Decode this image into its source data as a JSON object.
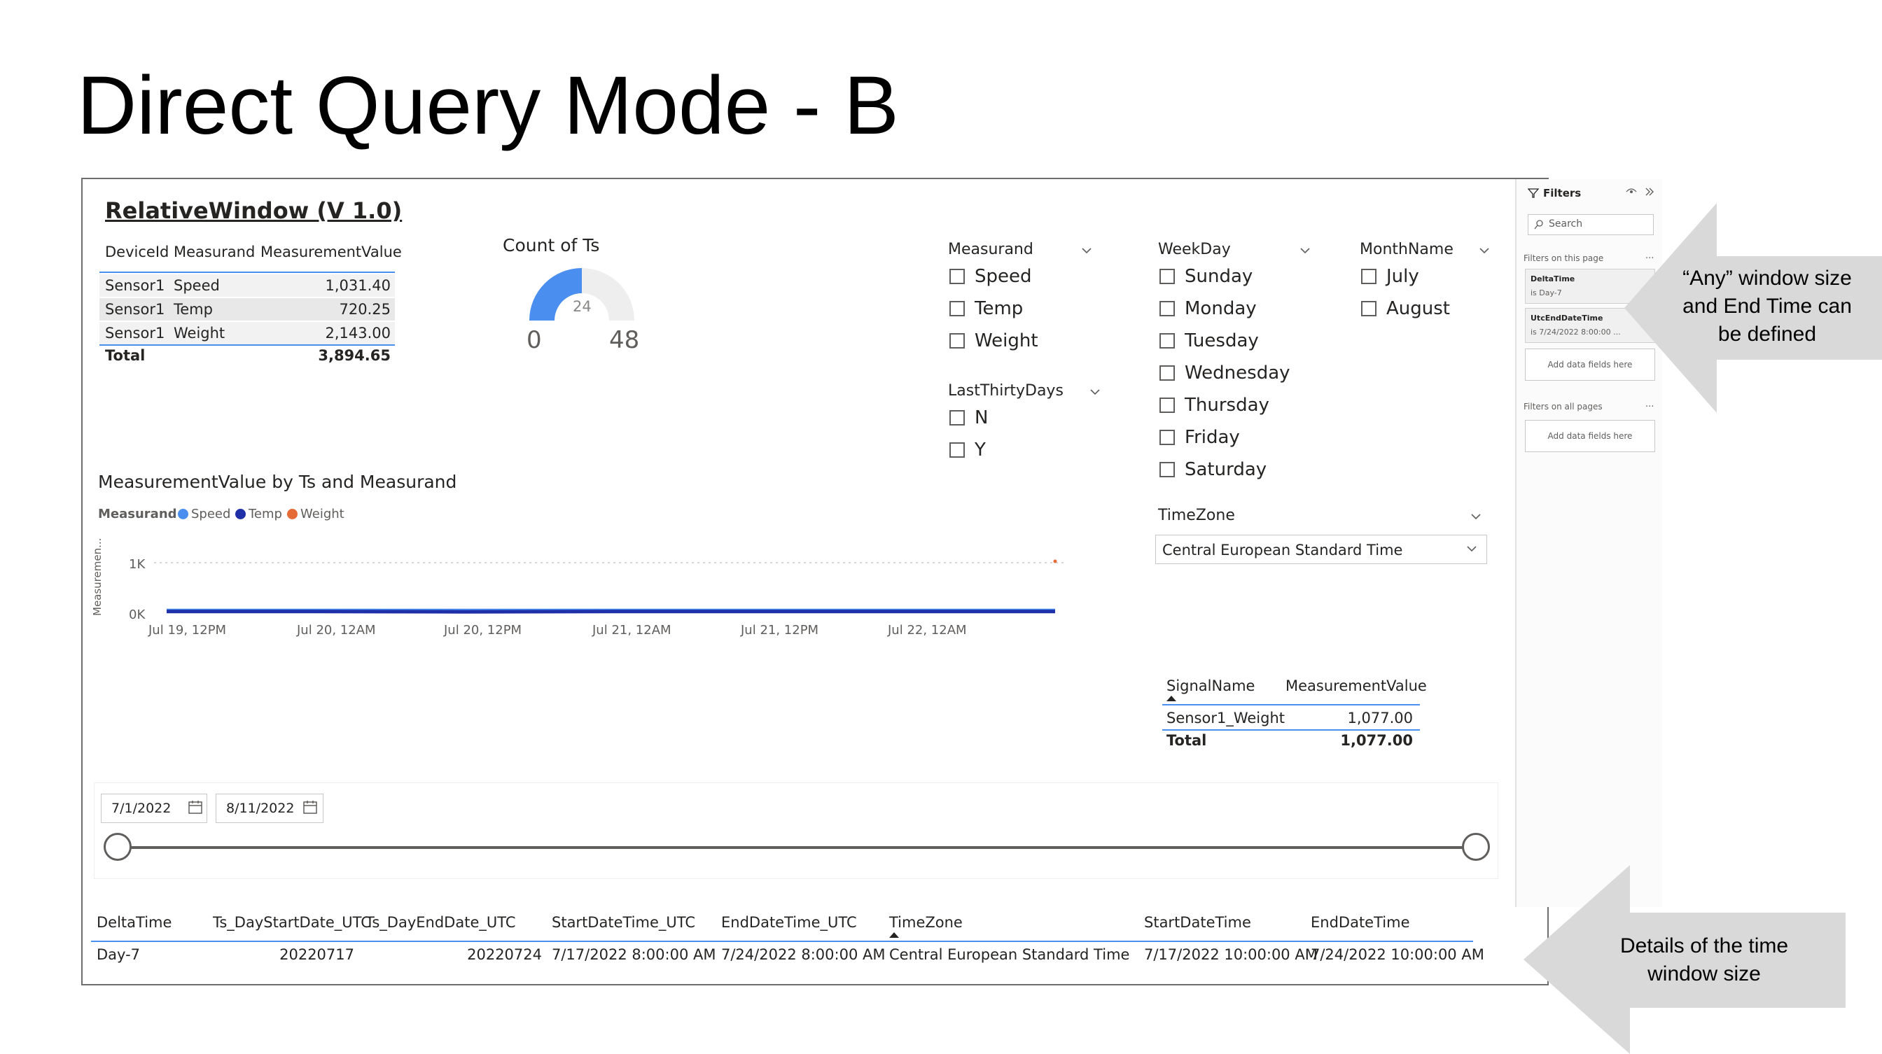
{
  "slide": {
    "title": "Direct Query Mode - B"
  },
  "summary_table": {
    "title": "RelativeWindow (V 1.0)",
    "headers": [
      "DeviceId",
      "Measurand",
      "MeasurementValue"
    ],
    "rows": [
      [
        "Sensor1",
        "Speed",
        "1,031.40"
      ],
      [
        "Sensor1",
        "Temp",
        "720.25"
      ],
      [
        "Sensor1",
        "Weight",
        "2,143.00"
      ]
    ],
    "total_label": "Total",
    "total_value": "3,894.65"
  },
  "gauge": {
    "title": "Count of Ts",
    "value": 24,
    "min": 0,
    "max": 48,
    "value_label": "24",
    "min_label": "0",
    "max_label": "48",
    "color": "#4a8ef0"
  },
  "slicers": {
    "measurand": {
      "title": "Measurand",
      "options": [
        "Speed",
        "Temp",
        "Weight"
      ]
    },
    "last_thirty_days": {
      "title": "LastThirtyDays",
      "options": [
        "N",
        "Y"
      ]
    },
    "weekday": {
      "title": "WeekDay",
      "options": [
        "Sunday",
        "Monday",
        "Tuesday",
        "Wednesday",
        "Thursday",
        "Friday",
        "Saturday"
      ]
    },
    "month_name": {
      "title": "MonthName",
      "options": [
        "July",
        "August"
      ]
    },
    "timezone": {
      "title": "TimeZone",
      "selected": "Central European Standard Time"
    }
  },
  "chart_data": {
    "type": "line",
    "title": "MeasurementValue by Ts and Measurand",
    "legend_title": "Measurand",
    "legend_position": "top-left",
    "ylabel": "Measuremen...",
    "xlabel": "",
    "y_ticks": [
      "1K",
      "0K"
    ],
    "ylim": [
      0,
      1000
    ],
    "x_ticks": [
      "Jul 19, 12PM",
      "Jul 20, 12AM",
      "Jul 20, 12PM",
      "Jul 21, 12AM",
      "Jul 21, 12PM",
      "Jul 22, 12AM"
    ],
    "x": [
      "Jul 19, 12PM",
      "Jul 20, 12AM",
      "Jul 20, 12PM",
      "Jul 21, 12AM",
      "Jul 21, 12PM",
      "Jul 22, 12AM",
      "Jul 22, 12PM"
    ],
    "grid": true,
    "series": [
      {
        "name": "Speed",
        "color": "#4a8ef0",
        "values": [
          60,
          60,
          60,
          60,
          60,
          60,
          60
        ]
      },
      {
        "name": "Temp",
        "color": "#1f2fa8",
        "values": [
          30,
          30,
          25,
          30,
          30,
          30,
          30
        ]
      },
      {
        "name": "Weight",
        "color": "#e66c37",
        "values": [
          null,
          null,
          null,
          null,
          null,
          null,
          1077
        ]
      }
    ]
  },
  "signal_table": {
    "headers": [
      "SignalName",
      "MeasurementValue"
    ],
    "rows": [
      [
        "Sensor1_Weight",
        "1,077.00"
      ]
    ],
    "total_label": "Total",
    "total_value": "1,077.00"
  },
  "date_range": {
    "start": "7/1/2022",
    "end": "8/11/2022",
    "slider_start": 0,
    "slider_end": 1
  },
  "details_table": {
    "headers": [
      "DeltaTime",
      "Ts_DayStartDate_UTC",
      "Ts_DayEndDate_UTC",
      "StartDateTime_UTC",
      "EndDateTime_UTC",
      "TimeZone",
      "StartDateTime",
      "EndDateTime"
    ],
    "row": [
      "Day-7",
      "20220717",
      "20220724",
      "7/17/2022 8:00:00 AM",
      "7/24/2022 8:00:00 AM",
      "Central European Standard Time",
      "7/17/2022 10:00:00 AM",
      "7/24/2022 10:00:00 AM"
    ]
  },
  "filters_pane": {
    "title": "Filters",
    "search_placeholder": "Search",
    "on_this_page": "Filters on this page",
    "cards": [
      {
        "name": "DeltaTime",
        "value": "is Day-7"
      },
      {
        "name": "UtcEndDateTime",
        "value": "is 7/24/2022 8:00:00 ..."
      }
    ],
    "add_fields": "Add data fields here",
    "on_all_pages": "Filters on all pages",
    "more": "..."
  },
  "callouts": {
    "top_right": "“Any” window size and End Time can be defined",
    "bottom_right": "Details of the time window size"
  }
}
